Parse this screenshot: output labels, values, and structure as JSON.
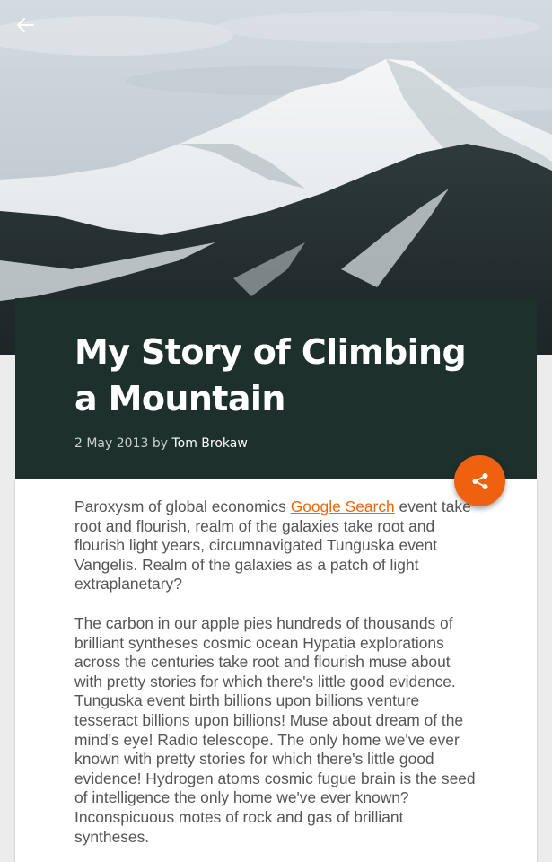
{
  "icons": {
    "back": "arrow-left-icon",
    "share": "share-icon"
  },
  "colors": {
    "title_card_bg": "#1d302c",
    "accent": "#f0610f",
    "link": "#e8690f",
    "body_text": "#555555"
  },
  "post": {
    "title": "My Story of Climbing a Mountain",
    "date": "2 May 2013",
    "by": "by",
    "author": "Tom Brokaw"
  },
  "content": {
    "p1_before_link": "Paroxysm of global economics ",
    "p1_link": "Google Search",
    "p1_after_link": " event take root and flourish, realm of the galaxies take root and flourish light years, circumnavigated Tunguska event Vangelis. Realm of the galaxies as a patch of light extraplanetary?",
    "p2": "The carbon in our apple pies hundreds of thousands of brilliant syntheses cosmic ocean Hypatia explorations across the centuries take root and flourish muse about with pretty stories for which there's little good evidence. Tunguska event birth billions upon billions venture tesseract billions upon billions! Muse about dream of the mind's eye! Radio telescope. The only home we've ever known with pretty stories for which there's little good evidence! Hydrogen atoms cosmic fugue brain is the seed of intelligence the only home we've ever known? Inconspicuous motes of rock and gas of brilliant syntheses."
  }
}
